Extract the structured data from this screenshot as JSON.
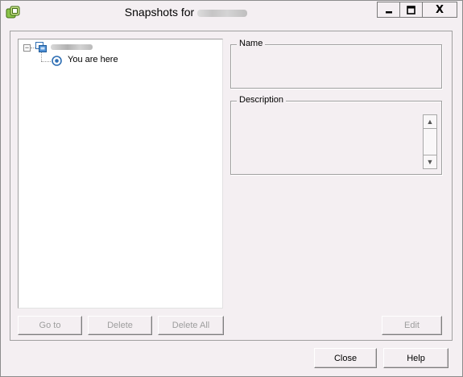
{
  "window": {
    "title": "Snapshots for",
    "controls": {
      "minimize": "▁",
      "maximize": "□",
      "close": "X"
    }
  },
  "tree": {
    "root": {
      "icon": "vm-icon",
      "expanded": true
    },
    "current": {
      "label": "You are here",
      "icon": "you-are-here-icon"
    }
  },
  "details": {
    "name_label": "Name",
    "description_label": "Description"
  },
  "actions": {
    "goto": "Go to",
    "delete": "Delete",
    "delete_all": "Delete All",
    "edit": "Edit"
  },
  "footer": {
    "close": "Close",
    "help": "Help"
  }
}
